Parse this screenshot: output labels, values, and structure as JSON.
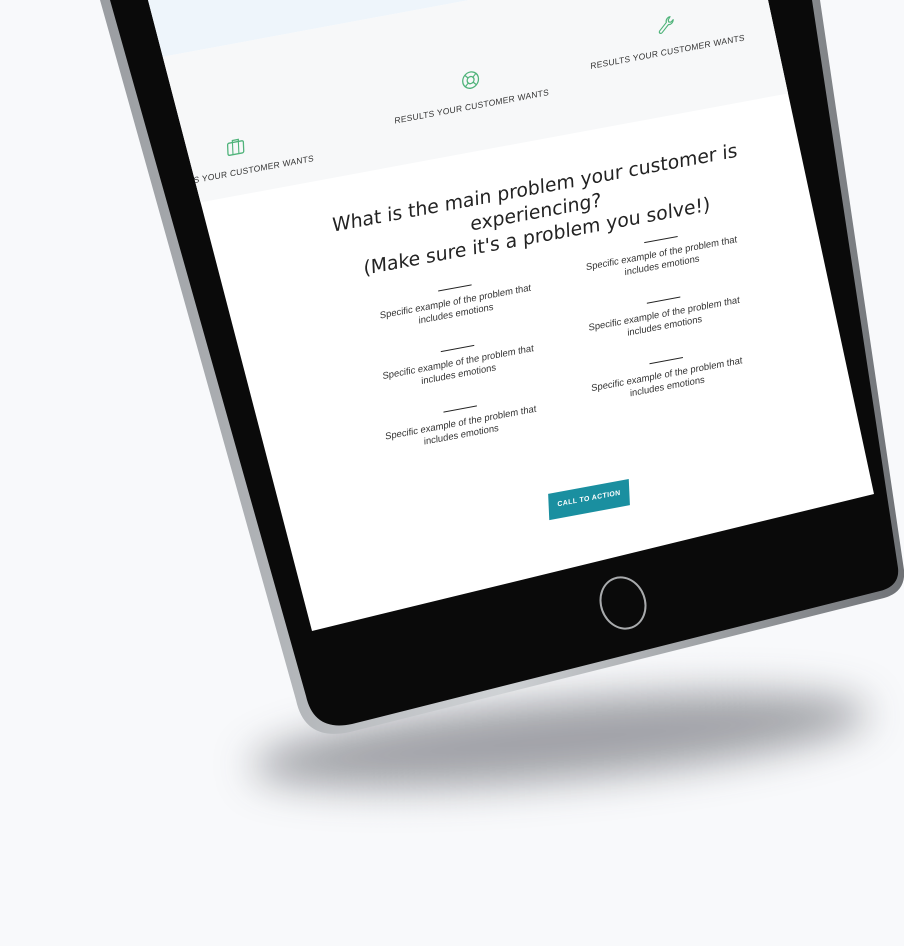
{
  "features": [
    {
      "label": "RESULTS YOUR CUSTOMER WANTS",
      "icon": "suitcase-icon"
    },
    {
      "label": "RESULTS YOUR CUSTOMER WANTS",
      "icon": "lifebuoy-icon"
    },
    {
      "label": "RESULTS YOUR CUSTOMER WANTS",
      "icon": "wrench-icon"
    }
  ],
  "problem": {
    "title_line1": "What is the main problem your customer is experiencing?",
    "title_line2": "(Make sure it's a problem you solve!)",
    "items": [
      {
        "line1": "Specific example of the problem that",
        "line2": "includes emotions"
      },
      {
        "line1": "Specific example of the problem that",
        "line2": "includes emotions"
      },
      {
        "line1": "Specific example of the problem that",
        "line2": "includes emotions"
      },
      {
        "line1": "Specific example of the problem that",
        "line2": "includes emotions"
      },
      {
        "line1": "Specific example of the problem that",
        "line2": "includes emotions"
      },
      {
        "line1": "Specific example of the problem that",
        "line2": "includes emotions"
      }
    ]
  },
  "cta_label": "CALL TO ACTION",
  "colors": {
    "accent": "#1a8fa0",
    "icon_green": "#4fb37a",
    "page_background": "#f8f9fb",
    "device_body": "#0a0a0a"
  }
}
